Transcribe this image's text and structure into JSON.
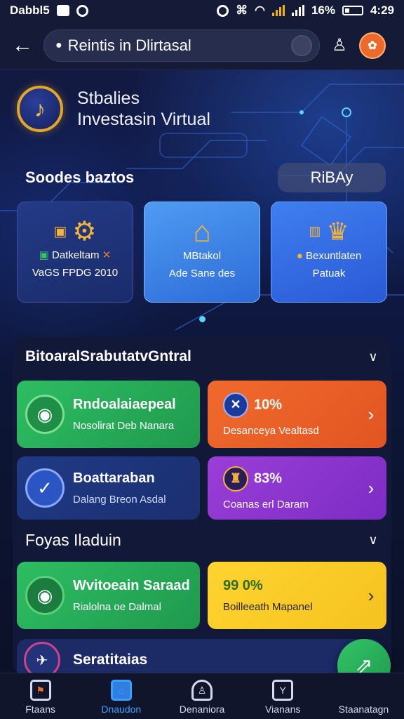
{
  "statusbar": {
    "carrier": "Dabbl5",
    "battery": "16%",
    "time": "4:29"
  },
  "topbar": {
    "search_value": "Reintis in Dlirtasal"
  },
  "brand": {
    "line1": "Stbalies",
    "line2": "Investasin Virtual"
  },
  "featured": {
    "title": "Soodes baztos",
    "pill": "RiBAy",
    "cards": [
      {
        "line1": "Datkeltam",
        "line2": "VaGS FPDG 2010"
      },
      {
        "line1": "MBtakol",
        "line2": "Ade Sane des"
      },
      {
        "line1": "Bexuntlaten",
        "line2": "Patuak"
      }
    ]
  },
  "section1": {
    "title": "BitoaralSrabutatvGntral",
    "tiles": [
      {
        "title": "Rndoalaiaepeal",
        "subtitle": "Nosolirat Deb Nanara"
      },
      {
        "title": "10%",
        "subtitle": "Desanceya Vealtasd"
      },
      {
        "title": "Boattaraban",
        "subtitle": "Dalang Breon Asdal"
      },
      {
        "title": "83%",
        "subtitle": "Coanas erl Daram"
      }
    ]
  },
  "section2": {
    "title": "Foyas Iladuin",
    "tiles": [
      {
        "title": "Wvitoeain Saraad",
        "subtitle": "Rialolna oe Dalmal"
      },
      {
        "title": "99 0%",
        "subtitle": "Boilleeath Mapanel"
      }
    ],
    "peek_title": "Seratitaias"
  },
  "bottomnav": {
    "items": [
      {
        "label": "Ftaans"
      },
      {
        "label": "Dnaudon"
      },
      {
        "label": "Denaniora"
      },
      {
        "label": "Vianans"
      },
      {
        "label": "Staanatagn"
      }
    ]
  },
  "colors": {
    "accent_blue": "#3aa0ff",
    "green": "#2ebd63",
    "orange": "#f06a2c",
    "purple": "#9a3ed8",
    "yellow": "#ffd42f"
  }
}
